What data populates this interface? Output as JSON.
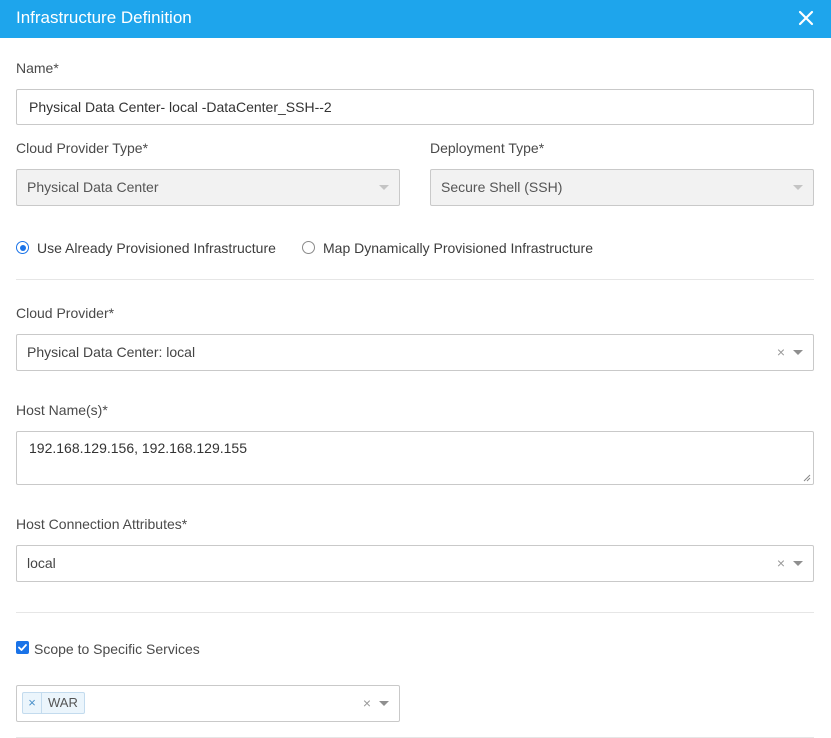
{
  "header": {
    "title": "Infrastructure Definition"
  },
  "name": {
    "label": "Name*",
    "value": "Physical Data Center- local -DataCenter_SSH--2"
  },
  "cloud_provider_type": {
    "label": "Cloud Provider Type*",
    "value": "Physical Data Center"
  },
  "deployment_type": {
    "label": "Deployment Type*",
    "value": "Secure Shell (SSH)"
  },
  "provisioning": {
    "option_existing": "Use Already Provisioned Infrastructure",
    "option_dynamic": "Map Dynamically Provisioned Infrastructure",
    "selected": "Use Already Provisioned Infrastructure"
  },
  "cloud_provider": {
    "label": "Cloud Provider*",
    "value": "Physical Data Center: local"
  },
  "host_names": {
    "label": "Host Name(s)*",
    "value": "192.168.129.156, 192.168.129.155"
  },
  "host_connection": {
    "label": "Host Connection Attributes*",
    "value": "local"
  },
  "scope": {
    "label": "Scope to Specific Services",
    "checked": true,
    "tags": [
      "WAR"
    ]
  },
  "colors": {
    "header": "#1ea5ec",
    "accent": "#1a73e8"
  },
  "icons": {
    "close": "close-icon",
    "clear": "clear-icon",
    "dropdown": "chevron-down-icon"
  }
}
